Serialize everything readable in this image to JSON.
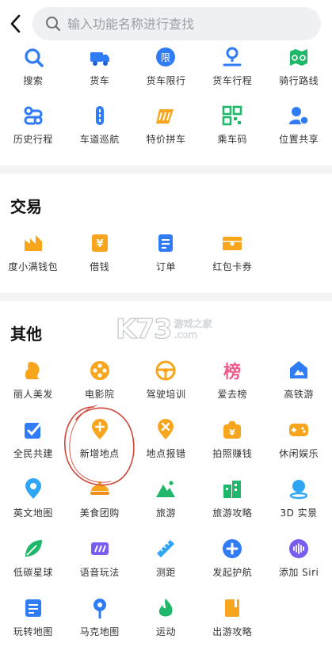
{
  "search": {
    "placeholder": "输入功能名称进行查找"
  },
  "sections": [
    {
      "title": "",
      "items": [
        {
          "label": "搜索",
          "icon": "search-icon"
        },
        {
          "label": "货车",
          "icon": "truck-icon"
        },
        {
          "label": "货车限行",
          "icon": "restriction-icon"
        },
        {
          "label": "货车行程",
          "icon": "route-pin-icon"
        },
        {
          "label": "骑行路线",
          "icon": "cycling-map-icon"
        },
        {
          "label": "历史行程",
          "icon": "history-route-icon"
        },
        {
          "label": "车道巡航",
          "icon": "lane-cruise-icon"
        },
        {
          "label": "特价拼车",
          "icon": "carpool-icon"
        },
        {
          "label": "乘车码",
          "icon": "qr-code-icon"
        },
        {
          "label": "位置共享",
          "icon": "location-share-icon"
        }
      ]
    },
    {
      "title": "交易",
      "items": [
        {
          "label": "度小满钱包",
          "icon": "wallet-icon"
        },
        {
          "label": "借钱",
          "icon": "loan-icon"
        },
        {
          "label": "订单",
          "icon": "order-icon"
        },
        {
          "label": "红包卡券",
          "icon": "coupon-icon"
        }
      ]
    },
    {
      "title": "其他",
      "items": [
        {
          "label": "丽人美发",
          "icon": "beauty-icon"
        },
        {
          "label": "电影院",
          "icon": "film-reel-icon"
        },
        {
          "label": "驾驶培训",
          "icon": "steering-wheel-icon"
        },
        {
          "label": "爱去榜",
          "icon": "ranking-icon"
        },
        {
          "label": "高铁游",
          "icon": "train-trip-icon"
        },
        {
          "label": "全民共建",
          "icon": "co-build-icon"
        },
        {
          "label": "新增地点",
          "icon": "add-place-icon"
        },
        {
          "label": "地点报错",
          "icon": "report-error-icon"
        },
        {
          "label": "拍照赚钱",
          "icon": "photo-money-icon"
        },
        {
          "label": "休闲娱乐",
          "icon": "gamepad-icon"
        },
        {
          "label": "英文地图",
          "icon": "english-map-icon"
        },
        {
          "label": "美食团购",
          "icon": "food-deal-icon"
        },
        {
          "label": "旅游",
          "icon": "mountain-icon"
        },
        {
          "label": "旅游攻略",
          "icon": "travel-guide-icon"
        },
        {
          "label": "3D 实景",
          "icon": "3d-view-icon"
        },
        {
          "label": "低碳星球",
          "icon": "leaf-icon"
        },
        {
          "label": "语音玩法",
          "icon": "voice-play-icon"
        },
        {
          "label": "测距",
          "icon": "ruler-icon"
        },
        {
          "label": "发起护航",
          "icon": "plus-circle-icon"
        },
        {
          "label": "添加 Siri",
          "icon": "siri-icon"
        },
        {
          "label": "玩转地图",
          "icon": "map-guide-icon"
        },
        {
          "label": "马克地图",
          "icon": "mark-pin-icon"
        },
        {
          "label": "运动",
          "icon": "flame-icon"
        },
        {
          "label": "出游攻略",
          "icon": "trip-book-icon"
        }
      ]
    }
  ],
  "watermark": {
    "main": "K73",
    "cn": "游戏之家",
    "en": ".com"
  },
  "colors": {
    "blue": "#2f7cf6",
    "orange": "#f7a51c",
    "green": "#1fb86b",
    "red": "#f0555a",
    "pink": "#f05d8c",
    "purple": "#7a5cf0",
    "annotation": "#d0463a"
  }
}
